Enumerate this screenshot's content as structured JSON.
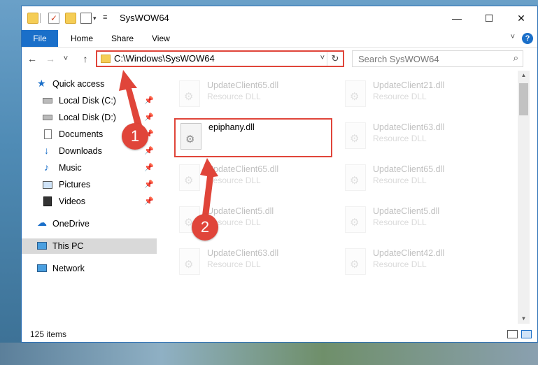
{
  "window": {
    "title": "SysWOW64",
    "minimize_glyph": "—",
    "maximize_glyph": "☐",
    "close_glyph": "✕"
  },
  "quick_access_toolbar": {
    "dropdown_glyph": "▾",
    "icons": [
      "folder-icon",
      "checkbox-icon",
      "properties-icon"
    ]
  },
  "ribbon": {
    "file_tab": "File",
    "tabs": [
      "Home",
      "Share",
      "View"
    ],
    "collapse_glyph": "˅",
    "help_glyph": "?"
  },
  "navigation": {
    "back_glyph": "←",
    "forward_glyph": "→",
    "recent_glyph": "˅",
    "up_glyph": "↑",
    "address": "C:\\Windows\\SysWOW64",
    "address_dropdown_glyph": "˅",
    "refresh_glyph": "↻",
    "search_placeholder": "Search SysWOW64",
    "search_glyph": "⌕"
  },
  "sidebar": {
    "pin_glyph": "📌",
    "items": [
      {
        "label": "Quick access",
        "icon": "star-icon"
      },
      {
        "label": "Local Disk (C:)",
        "icon": "drive-icon"
      },
      {
        "label": "Local Disk (D:)",
        "icon": "drive-icon"
      },
      {
        "label": "Documents",
        "icon": "documents-icon"
      },
      {
        "label": "Downloads",
        "icon": "download-icon"
      },
      {
        "label": "Music",
        "icon": "music-icon"
      },
      {
        "label": "Pictures",
        "icon": "pictures-icon"
      },
      {
        "label": "Videos",
        "icon": "videos-icon"
      },
      {
        "label": "OneDrive",
        "icon": "cloud-icon"
      },
      {
        "label": "This PC",
        "icon": "computer-icon"
      },
      {
        "label": "Network",
        "icon": "network-icon"
      }
    ],
    "selected": "This PC"
  },
  "files": [
    {
      "name": "UpdateClient65.dll",
      "type": "Resource DLL"
    },
    {
      "name": "UpdateClient21.dll",
      "type": "Resource DLL"
    },
    {
      "name": "epiphany.dll",
      "type": ""
    },
    {
      "name": "UpdateClient63.dll",
      "type": "Resource DLL"
    },
    {
      "name": "UpdateClient65.dll",
      "type": "Resource DLL"
    },
    {
      "name": "UpdateClient65.dll",
      "type": "Resource DLL"
    },
    {
      "name": "UpdateClient5.dll",
      "type": "Resource DLL"
    },
    {
      "name": "UpdateClient5.dll",
      "type": "Resource DLL"
    },
    {
      "name": "UpdateClient63.dll",
      "type": "Resource DLL"
    },
    {
      "name": "UpdateClient42.dll",
      "type": "Resource DLL"
    }
  ],
  "status": {
    "item_count": "125 items"
  },
  "scrollbar": {
    "up_glyph": "▲",
    "down_glyph": "▼"
  },
  "callouts": {
    "step1": "1",
    "step2": "2",
    "color": "#e0453a"
  }
}
